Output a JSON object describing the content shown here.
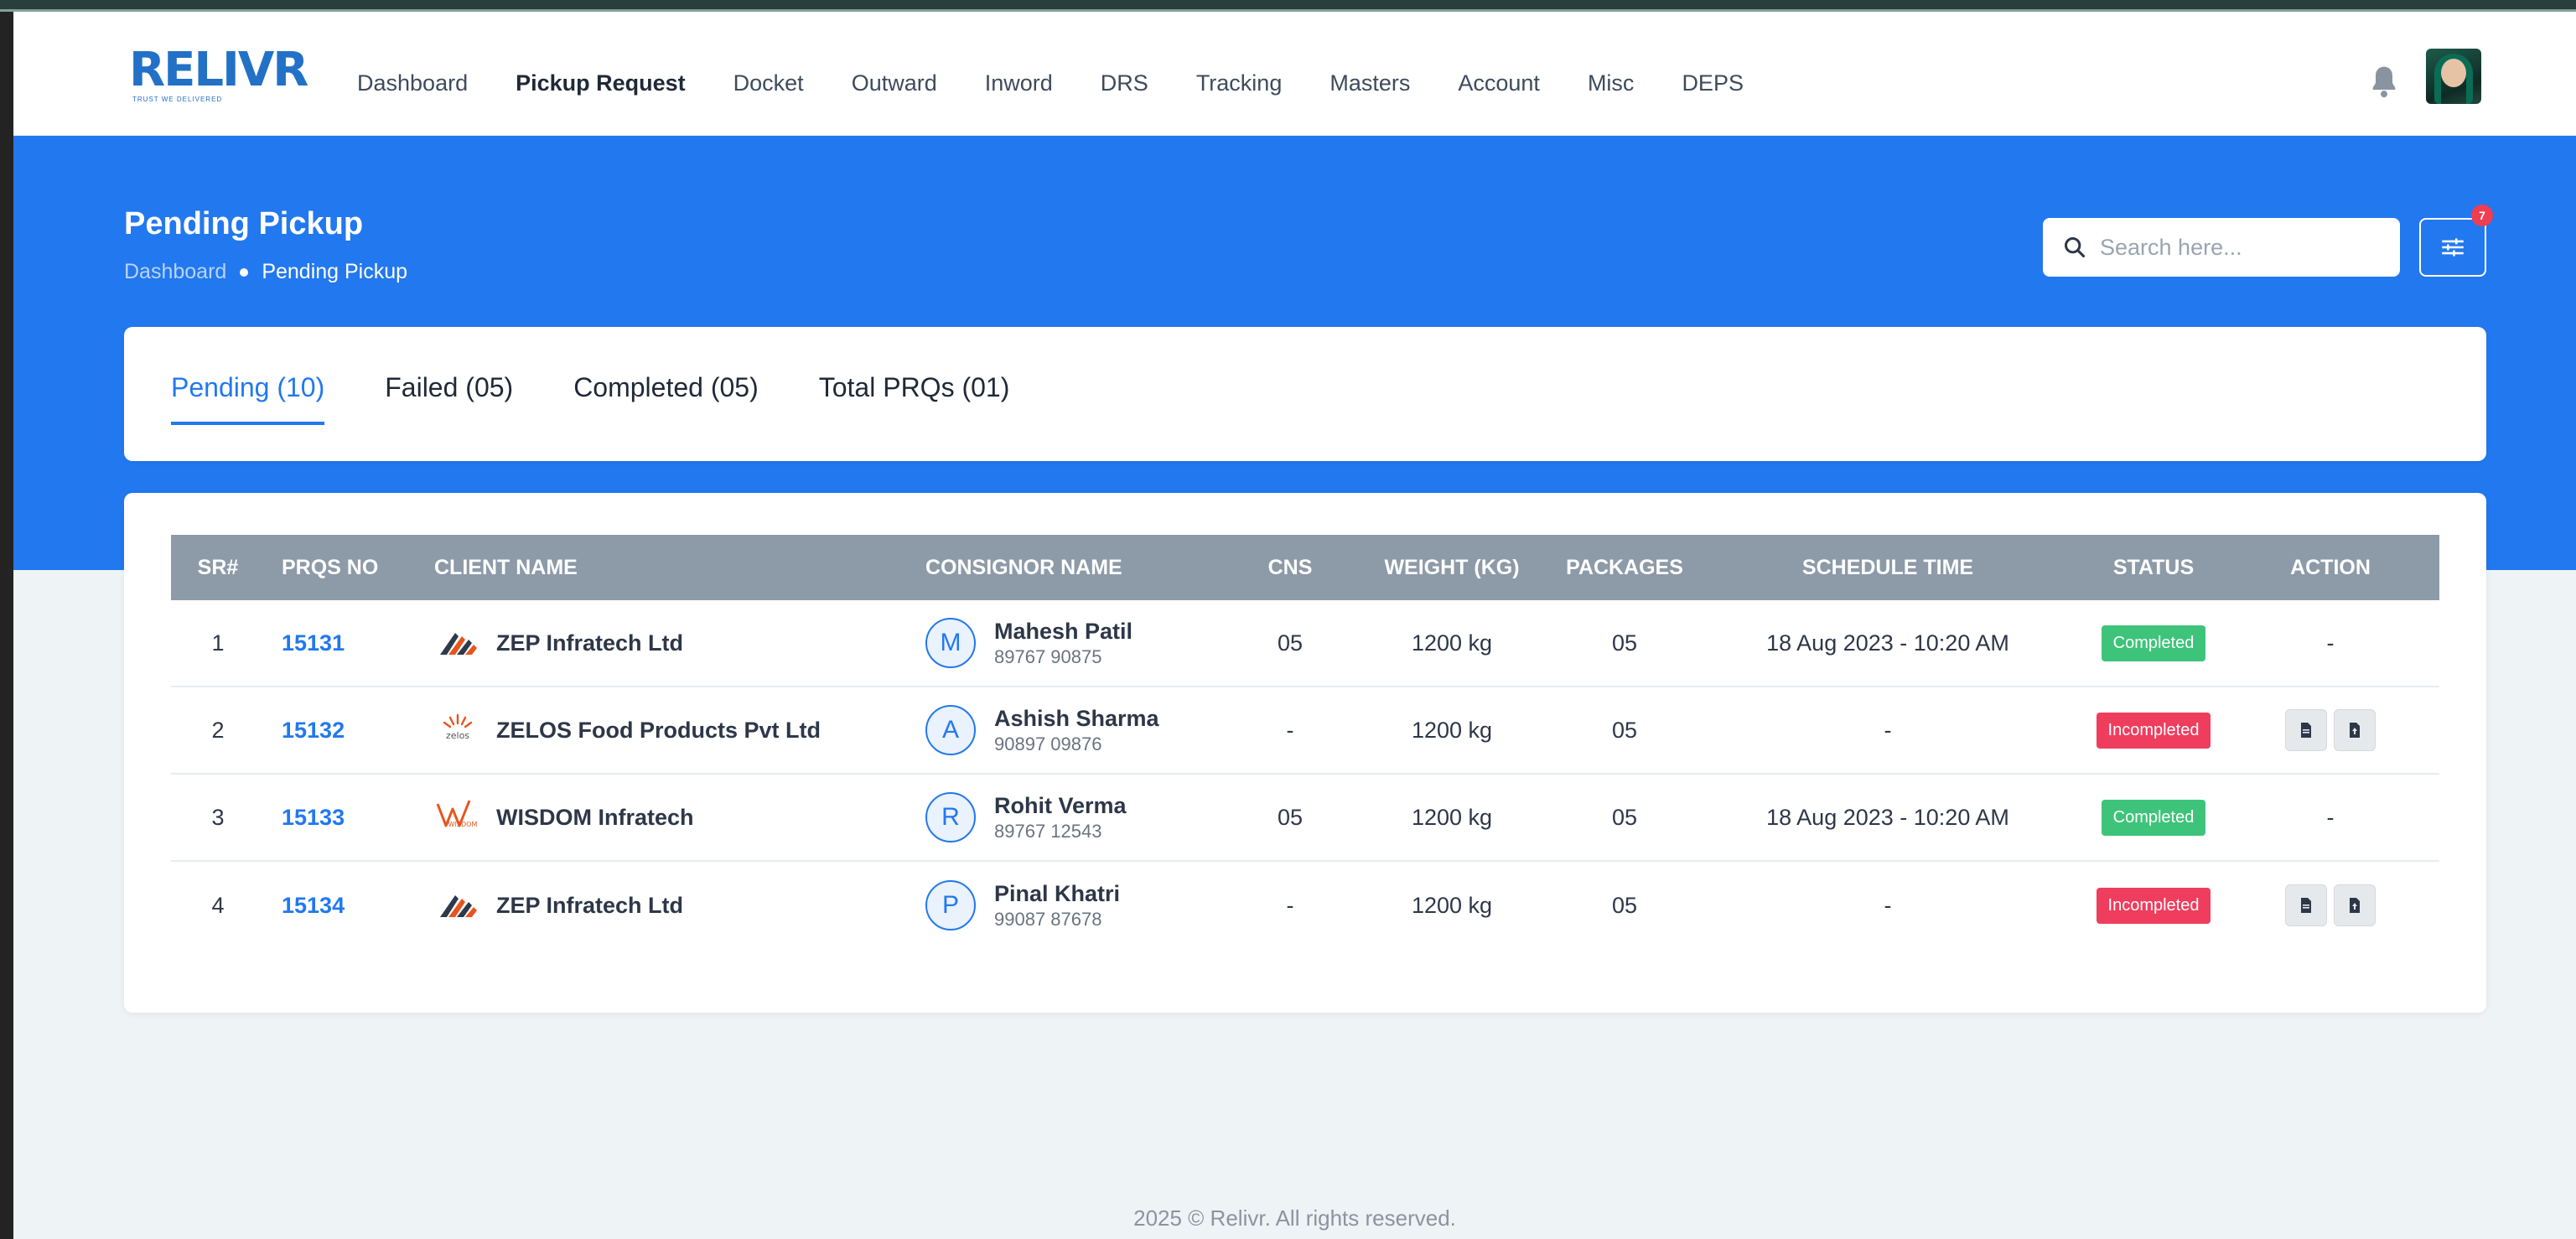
{
  "app": {
    "logo": "RELIVR",
    "logo_tagline": "TRUST WE DELIVERED"
  },
  "nav": {
    "items": [
      {
        "label": "Dashboard"
      },
      {
        "label": "Pickup Request"
      },
      {
        "label": "Docket"
      },
      {
        "label": "Outward"
      },
      {
        "label": "Inword"
      },
      {
        "label": "DRS"
      },
      {
        "label": "Tracking"
      },
      {
        "label": "Masters"
      },
      {
        "label": "Account"
      },
      {
        "label": "Misc"
      },
      {
        "label": "DEPS"
      }
    ],
    "active": "Pickup Request"
  },
  "header": {
    "bell_icon": "bell-icon",
    "avatar": "user-avatar"
  },
  "page": {
    "title": "Pending Pickup",
    "breadcrumb": {
      "home": "Dashboard",
      "current": "Pending Pickup"
    }
  },
  "search": {
    "placeholder": "Search here..."
  },
  "filter": {
    "badge": "7"
  },
  "tabs": [
    {
      "label": "Pending (10)",
      "active": true
    },
    {
      "label": "Failed (05)"
    },
    {
      "label": "Completed (05)"
    },
    {
      "label": "Total PRQs (01)"
    }
  ],
  "table": {
    "headers": {
      "sr": "SR#",
      "prq": "PRQS NO",
      "client": "CLIENT NAME",
      "consignor": "CONSIGNOR NAME",
      "cns": "CNS",
      "weight": "WEIGHT (KG)",
      "packages": "PACKAGES",
      "schedule": "SCHEDULE TIME",
      "status": "STATUS",
      "action": "ACTION"
    },
    "rows": [
      {
        "sr": "1",
        "prq": "15131",
        "client": "ZEP Infratech Ltd",
        "client_logo": "zep",
        "cons_initial": "M",
        "cons_name": "Mahesh Patil",
        "cons_phone": "89767 90875",
        "cns": "05",
        "weight": "1200 kg",
        "packages": "05",
        "schedule": "18 Aug 2023 - 10:20 AM",
        "status": "Completed",
        "action": "-"
      },
      {
        "sr": "2",
        "prq": "15132",
        "client": "ZELOS Food Products Pvt Ltd",
        "client_logo": "zelos",
        "client_logo_text": "zelos",
        "cons_initial": "A",
        "cons_name": "Ashish Sharma",
        "cons_phone": "90897 09876",
        "cns": "-",
        "weight": "1200 kg",
        "packages": "05",
        "schedule": "-",
        "status": "Incompleted",
        "action": "buttons"
      },
      {
        "sr": "3",
        "prq": "15133",
        "client": "WISDOM Infratech",
        "client_logo": "wisdom",
        "client_logo_text": "WISDOM",
        "cons_initial": "R",
        "cons_name": "Rohit Verma",
        "cons_phone": "89767 12543",
        "cns": "05",
        "weight": "1200 kg",
        "packages": "05",
        "schedule": "18 Aug 2023 - 10:20 AM",
        "status": "Completed",
        "action": "-"
      },
      {
        "sr": "4",
        "prq": "15134",
        "client": "ZEP Infratech Ltd",
        "client_logo": "zep",
        "cons_initial": "P",
        "cons_name": "Pinal Khatri",
        "cons_phone": "99087 87678",
        "cns": "-",
        "weight": "1200 kg",
        "packages": "05",
        "schedule": "-",
        "status": "Incompleted",
        "action": "buttons"
      }
    ]
  },
  "footer": {
    "text": "2025 © Relivr. All rights reserved."
  },
  "colors": {
    "primary": "#2278ef",
    "completed": "#3ec47a",
    "incompleted": "#ef3d5e",
    "table_header": "#8d9aa8"
  }
}
